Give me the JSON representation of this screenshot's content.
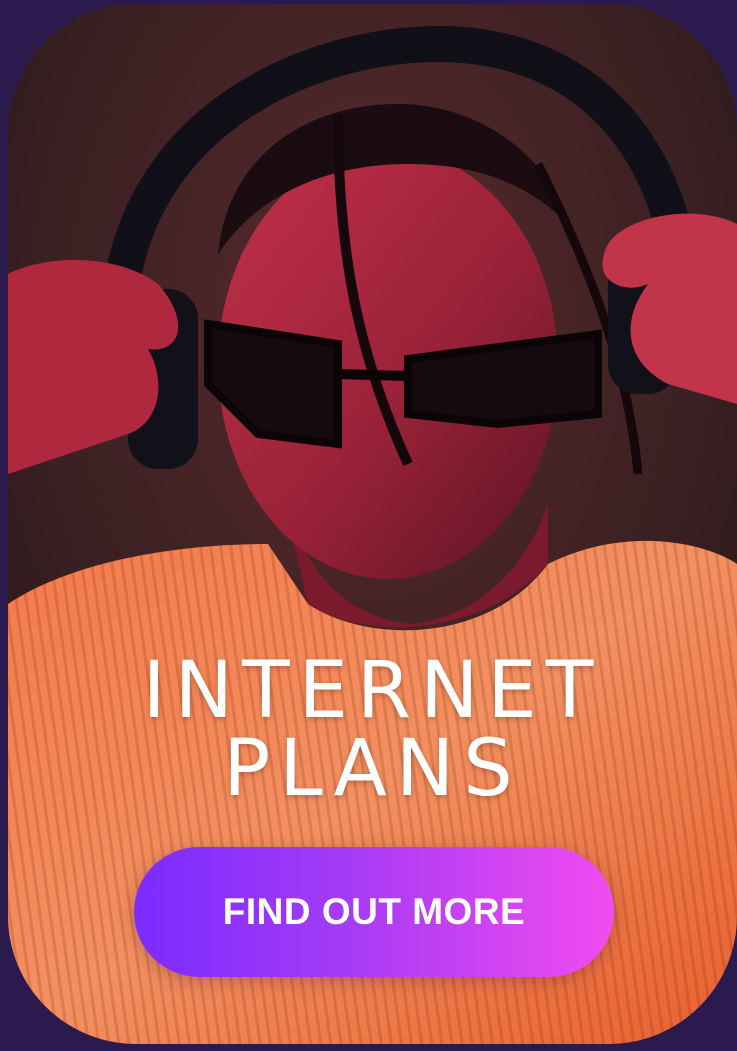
{
  "banner": {
    "headline_line1": "INTERNET",
    "headline_line2": "PLANS",
    "cta_label": "FIND OUT MORE"
  },
  "colors": {
    "page_background": "#2a1a4e",
    "cta_gradient_start": "#7a2cff",
    "cta_gradient_end": "#f24bf0",
    "text": "#ffffff",
    "sweater": "#f08a55"
  },
  "photo": {
    "subject": "person-wearing-headphones-and-sunglasses"
  }
}
